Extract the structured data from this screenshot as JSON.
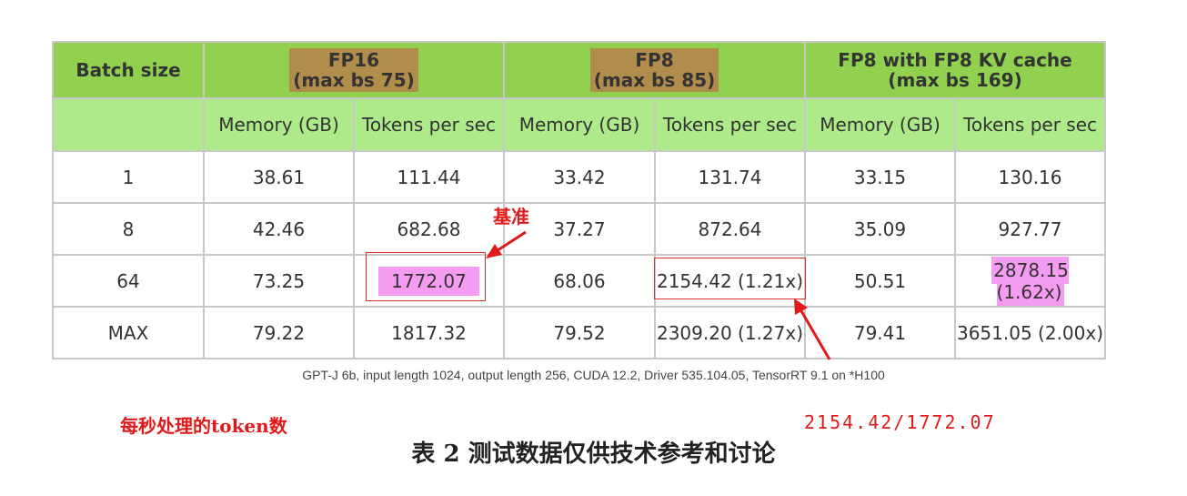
{
  "table": {
    "header": {
      "batch_size": "Batch size",
      "fp16_title": "FP16",
      "fp16_max": "(max bs 75)",
      "fp8_title": "FP8",
      "fp8_max": "(max bs 85)",
      "fp8kv_title": "FP8 with FP8 KV cache",
      "fp8kv_max": "(max bs 169)"
    },
    "subheader": {
      "memory": "Memory (GB)",
      "tokens": "Tokens per sec"
    },
    "rows": [
      {
        "bs": "1",
        "fp16_mem": "38.61",
        "fp16_tps": "111.44",
        "fp8_mem": "33.42",
        "fp8_tps": "131.74",
        "fp8kv_mem": "33.15",
        "fp8kv_tps": "130.16"
      },
      {
        "bs": "8",
        "fp16_mem": "42.46",
        "fp16_tps": "682.68",
        "fp8_mem": "37.27",
        "fp8_tps": "872.64",
        "fp8kv_mem": "35.09",
        "fp8kv_tps": "927.77"
      },
      {
        "bs": "64",
        "fp16_mem": "73.25",
        "fp16_tps": "1772.07",
        "fp8_mem": "68.06",
        "fp8_tps": "2154.42 (1.21x)",
        "fp8kv_mem": "50.51",
        "fp8kv_tps": "2878.15 (1.62x)"
      },
      {
        "bs": "MAX",
        "fp16_mem": "79.22",
        "fp16_tps": "1817.32",
        "fp8_mem": "79.52",
        "fp8_tps": "2309.20 (1.27x)",
        "fp8kv_mem": "79.41",
        "fp8kv_tps": "3651.05 (2.00x)"
      }
    ]
  },
  "caption": "GPT-J 6b, input length 1024, output length 256,  CUDA 12.2, Driver 535.104.05, TensorRT  9.1 on *H100",
  "annotations": {
    "baseline": "基准",
    "tokens_per_sec_note": "每秒处理的token数",
    "ratio_note": "2154.42/1772.07"
  },
  "title": "表 2 测试数据仅供技术参考和讨论",
  "colors": {
    "header_green": "#92d050",
    "subheader_green": "#aee98a",
    "highlight_brown": "#b08d4a",
    "highlight_pink": "#f49cf2",
    "annotation_red": "#e0191a"
  }
}
